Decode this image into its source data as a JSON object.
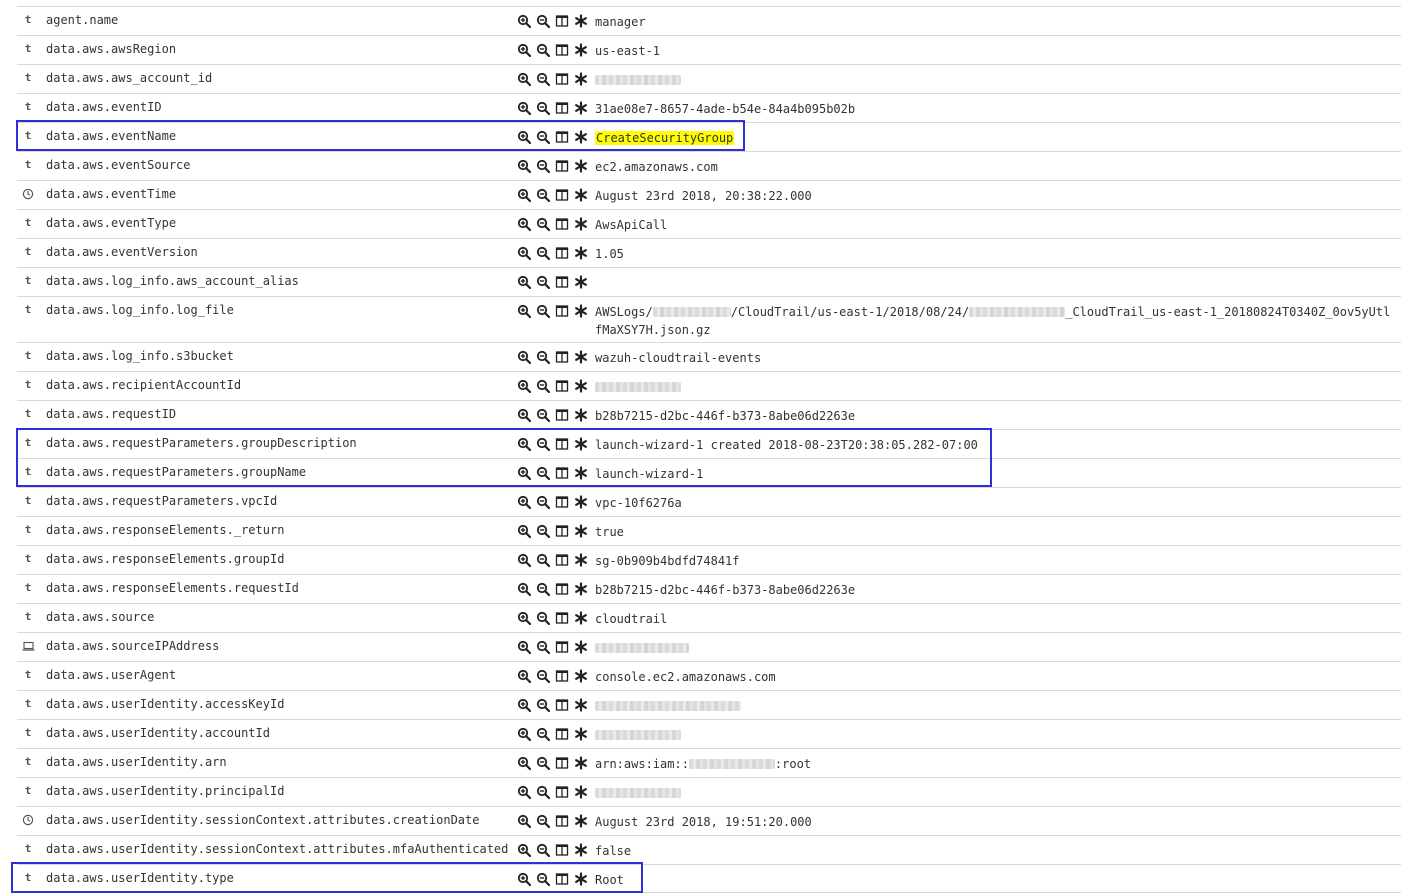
{
  "rows": [
    {
      "type": "t",
      "field": "agent.name",
      "value": "manager"
    },
    {
      "type": "t",
      "field": "data.aws.awsRegion",
      "value": "us-east-1"
    },
    {
      "type": "t",
      "field": "data.aws.aws_account_id",
      "value": "",
      "redacted": [
        86
      ]
    },
    {
      "type": "t",
      "field": "data.aws.eventID",
      "value": "31ae08e7-8657-4ade-b54e-84a4b095b02b"
    },
    {
      "type": "t",
      "field": "data.aws.eventName",
      "value": "CreateSecurityGroup",
      "highlight": true
    },
    {
      "type": "t",
      "field": "data.aws.eventSource",
      "value": "ec2.amazonaws.com"
    },
    {
      "type": "date",
      "field": "data.aws.eventTime",
      "value": "August 23rd 2018, 20:38:22.000"
    },
    {
      "type": "t",
      "field": "data.aws.eventType",
      "value": "AwsApiCall"
    },
    {
      "type": "t",
      "field": "data.aws.eventVersion",
      "value": "1.05"
    },
    {
      "type": "t",
      "field": "data.aws.log_info.aws_account_alias",
      "value": ""
    },
    {
      "type": "t",
      "field": "data.aws.log_info.log_file",
      "value": "",
      "tall": true,
      "parts": [
        "AWSLogs/",
        "#R78",
        "/CloudTrail/us-east-1/2018/08/24/",
        "#R96",
        "_CloudTrail_us-east-1_20180824T0340Z_0ov5yUtl fMaXSY7H.json.gz"
      ]
    },
    {
      "type": "t",
      "field": "data.aws.log_info.s3bucket",
      "value": "wazuh-cloudtrail-events"
    },
    {
      "type": "t",
      "field": "data.aws.recipientAccountId",
      "value": "",
      "redacted": [
        86
      ]
    },
    {
      "type": "t",
      "field": "data.aws.requestID",
      "value": "b28b7215-d2bc-446f-b373-8abe06d2263e"
    },
    {
      "type": "t",
      "field": "data.aws.requestParameters.groupDescription",
      "value": "launch-wizard-1 created 2018-08-23T20:38:05.282-07:00"
    },
    {
      "type": "t",
      "field": "data.aws.requestParameters.groupName",
      "value": "launch-wizard-1"
    },
    {
      "type": "t",
      "field": "data.aws.requestParameters.vpcId",
      "value": "vpc-10f6276a"
    },
    {
      "type": "t",
      "field": "data.aws.responseElements._return",
      "value": "true"
    },
    {
      "type": "t",
      "field": "data.aws.responseElements.groupId",
      "value": "sg-0b909b4bdfd74841f"
    },
    {
      "type": "t",
      "field": "data.aws.responseElements.requestId",
      "value": "b28b7215-d2bc-446f-b373-8abe06d2263e"
    },
    {
      "type": "t",
      "field": "data.aws.source",
      "value": "cloudtrail"
    },
    {
      "type": "ip",
      "field": "data.aws.sourceIPAddress",
      "value": "",
      "redacted": [
        94
      ]
    },
    {
      "type": "t",
      "field": "data.aws.userAgent",
      "value": "console.ec2.amazonaws.com"
    },
    {
      "type": "t",
      "field": "data.aws.userIdentity.accessKeyId",
      "value": "",
      "redacted": [
        146
      ]
    },
    {
      "type": "t",
      "field": "data.aws.userIdentity.accountId",
      "value": "",
      "redacted": [
        86
      ]
    },
    {
      "type": "t",
      "field": "data.aws.userIdentity.arn",
      "value": "",
      "parts": [
        "arn:aws:iam::",
        "#R86",
        ":root"
      ]
    },
    {
      "type": "t",
      "field": "data.aws.userIdentity.principalId",
      "value": "",
      "redacted": [
        86
      ]
    },
    {
      "type": "date",
      "field": "data.aws.userIdentity.sessionContext.attributes.creationDate",
      "value": "August 23rd 2018, 19:51:20.000"
    },
    {
      "type": "t",
      "field": "data.aws.userIdentity.sessionContext.attributes.mfaAuthenticated",
      "value": "false"
    },
    {
      "type": "t",
      "field": "data.aws.userIdentity.type",
      "value": "Root"
    }
  ],
  "icons": {
    "string_type": "t",
    "filter_for": "zoom-in-icon",
    "filter_out": "zoom-out-icon",
    "toggle_column": "column-icon",
    "filter_exists": "asterisk-icon"
  },
  "colors": {
    "highlight_box": "#2f2fd8",
    "value_highlight": "#ffff00",
    "row_border": "#d9d9d9"
  }
}
